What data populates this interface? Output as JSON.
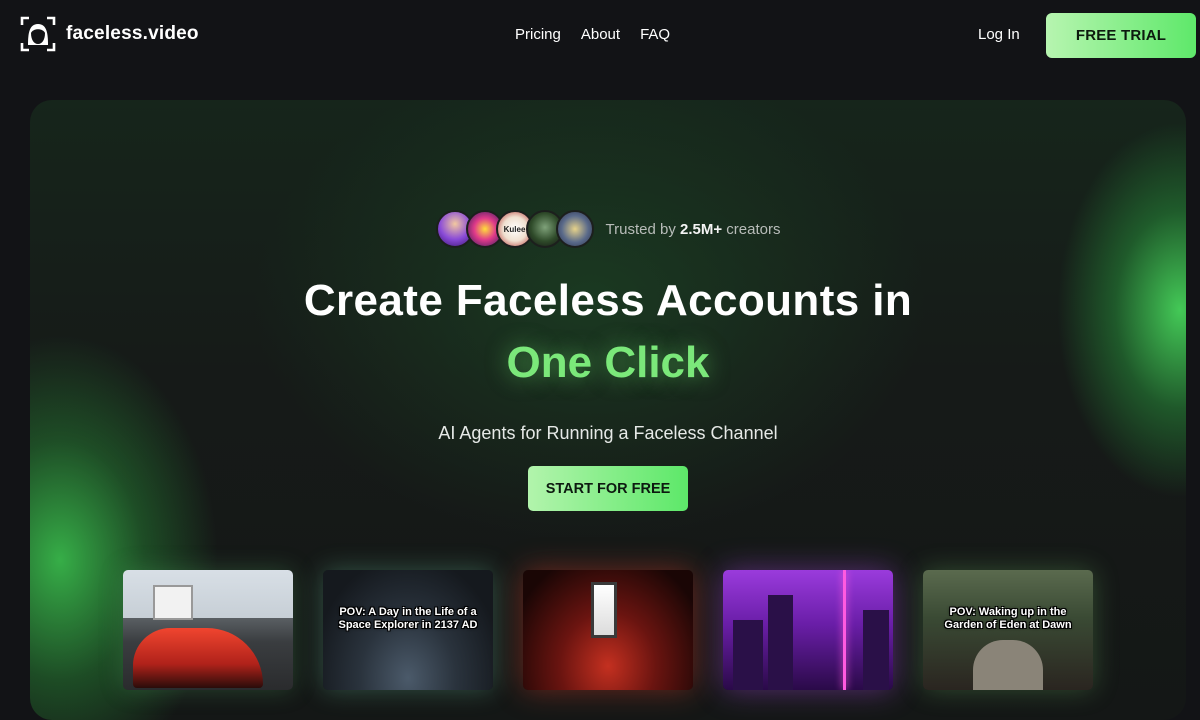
{
  "nav": {
    "brand": "faceless.video",
    "links": [
      "Pricing",
      "About",
      "FAQ"
    ],
    "login": "Log In",
    "trial": "FREE TRIAL"
  },
  "hero": {
    "trusted_prefix": "Trusted by ",
    "trusted_count": "2.5M+",
    "trusted_suffix": " creators",
    "avatars": [
      "avatar-1",
      "avatar-2",
      "Kulee",
      "avatar-4",
      "avatar-5"
    ],
    "headline": "Create Faceless Accounts in",
    "headline_accent": "One Click",
    "subtitle": "AI Agents for Running a Faceless Channel",
    "cta": "START FOR FREE"
  },
  "thumbnails": [
    {
      "caption": ""
    },
    {
      "caption": "POV: A Day in the Life of a Space Explorer in 2137 AD"
    },
    {
      "caption": ""
    },
    {
      "caption": ""
    },
    {
      "caption": "POV: Waking up in the Garden of Eden at Dawn"
    }
  ],
  "colors": {
    "accent": "#7be87a",
    "button_from": "#b2f4ac",
    "button_to": "#5de869",
    "background": "#121316"
  }
}
